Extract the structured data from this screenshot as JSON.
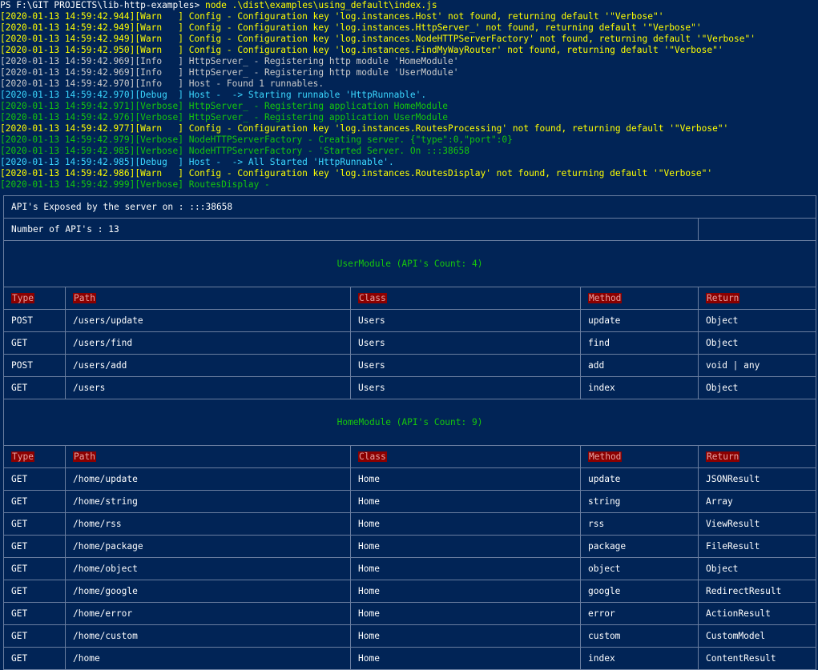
{
  "terminal": {
    "prompt": "PS F:\\GIT PROJECTS\\lib-http-examples> ",
    "command": "node .\\dist\\examples\\using_default\\index.js",
    "log_lines": [
      {
        "level": "warn",
        "text": "[2020-01-13 14:59:42.944][Warn   ] Config - Configuration key 'log.instances.Host' not found, returning default '\"Verbose\"'"
      },
      {
        "level": "warn",
        "text": "[2020-01-13 14:59:42.949][Warn   ] Config - Configuration key 'log.instances.HttpServer_' not found, returning default '\"Verbose\"'"
      },
      {
        "level": "warn",
        "text": "[2020-01-13 14:59:42.949][Warn   ] Config - Configuration key 'log.instances.NodeHTTPServerFactory' not found, returning default '\"Verbose\"'"
      },
      {
        "level": "warn",
        "text": "[2020-01-13 14:59:42.950][Warn   ] Config - Configuration key 'log.instances.FindMyWayRouter' not found, returning default '\"Verbose\"'"
      },
      {
        "level": "info",
        "text": "[2020-01-13 14:59:42.969][Info   ] HttpServer_ - Registering http module 'HomeModule'"
      },
      {
        "level": "info",
        "text": "[2020-01-13 14:59:42.969][Info   ] HttpServer_ - Registering http module 'UserModule'"
      },
      {
        "level": "info",
        "text": "[2020-01-13 14:59:42.970][Info   ] Host - Found 1 runnables."
      },
      {
        "level": "debug",
        "text": "[2020-01-13 14:59:42.970][Debug  ] Host -  -> Starting runnable 'HttpRunnable'."
      },
      {
        "level": "verbose",
        "text": "[2020-01-13 14:59:42.971][Verbose] HttpServer_ - Registering application HomeModule"
      },
      {
        "level": "verbose",
        "text": "[2020-01-13 14:59:42.976][Verbose] HttpServer_ - Registering application UserModule"
      },
      {
        "level": "warn",
        "text": "[2020-01-13 14:59:42.977][Warn   ] Config - Configuration key 'log.instances.RoutesProcessing' not found, returning default '\"Verbose\"'"
      },
      {
        "level": "verbose",
        "text": "[2020-01-13 14:59:42.979][Verbose] NodeHTTPServerFactory - Creating server. {\"type\":0,\"port\":0}"
      },
      {
        "level": "verbose",
        "text": "[2020-01-13 14:59:42.985][Verbose] NodeHTTPServerFactory - 'Started Server. On :::38658"
      },
      {
        "level": "debug",
        "text": "[2020-01-13 14:59:42.985][Debug  ] Host -  -> All Started 'HttpRunnable'."
      },
      {
        "level": "warn",
        "text": "[2020-01-13 14:59:42.986][Warn   ] Config - Configuration key 'log.instances.RoutesDisplay' not found, returning default '\"Verbose\"'"
      },
      {
        "level": "verbose",
        "text": "[2020-01-13 14:59:42.999][Verbose] RoutesDisplay -"
      }
    ]
  },
  "routes_table": {
    "exposed_label": "API's Exposed by the server on : :::38658",
    "count_label": "Number of API's : 13",
    "headers": [
      "Type",
      "Path",
      "Class",
      "Method",
      "Return"
    ],
    "modules": [
      {
        "title": "UserModule (API's Count: 4)",
        "rows": [
          [
            "POST",
            "/users/update",
            "Users",
            "update",
            "Object"
          ],
          [
            "GET",
            "/users/find",
            "Users",
            "find",
            "Object"
          ],
          [
            "POST",
            "/users/add",
            "Users",
            "add",
            "void | any"
          ],
          [
            "GET",
            "/users",
            "Users",
            "index",
            "Object"
          ]
        ]
      },
      {
        "title": "HomeModule (API's Count: 9)",
        "rows": [
          [
            "GET",
            "/home/update",
            "Home",
            "update",
            "JSONResult"
          ],
          [
            "GET",
            "/home/string",
            "Home",
            "string",
            "Array"
          ],
          [
            "GET",
            "/home/rss",
            "Home",
            "rss",
            "ViewResult"
          ],
          [
            "GET",
            "/home/package",
            "Home",
            "package",
            "FileResult"
          ],
          [
            "GET",
            "/home/object",
            "Home",
            "object",
            "Object"
          ],
          [
            "GET",
            "/home/google",
            "Home",
            "google",
            "RedirectResult"
          ],
          [
            "GET",
            "/home/error",
            "Home",
            "error",
            "ActionResult"
          ],
          [
            "GET",
            "/home/custom",
            "Home",
            "custom",
            "CustomModel"
          ],
          [
            "GET",
            "/home",
            "Home",
            "index",
            "ContentResult"
          ]
        ]
      }
    ]
  }
}
